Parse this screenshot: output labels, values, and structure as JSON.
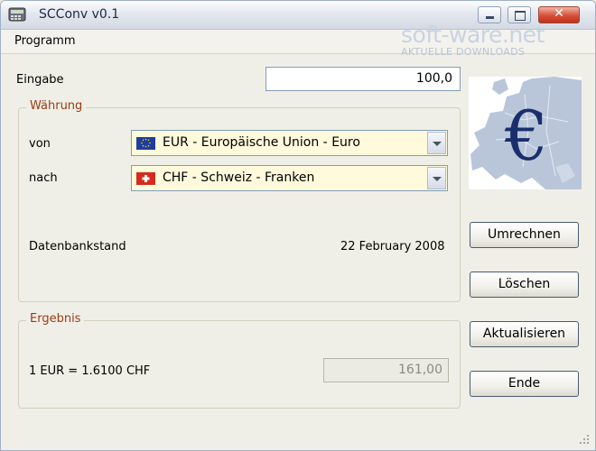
{
  "window": {
    "title": "SCConv v0.1"
  },
  "menu": {
    "items": [
      "Programm"
    ]
  },
  "watermark": {
    "brand": "soft-ware.net",
    "sub": "AKTUELLE DOWNLOADS"
  },
  "eingabe": {
    "label": "Eingabe",
    "value": "100,0"
  },
  "waehrung": {
    "title": "Währung",
    "von_label": "von",
    "von_value": "EUR - Europäische Union - Euro",
    "nach_label": "nach",
    "nach_value": "CHF - Schweiz - Franken",
    "db_label": "Datenbankstand",
    "db_date": "22 February 2008"
  },
  "ergebnis": {
    "title": "Ergebnis",
    "rate_text": "1 EUR = 1.6100 CHF",
    "value": "161,00"
  },
  "buttons": {
    "umrechnen": "Umrechnen",
    "loeschen": "Löschen",
    "aktualisieren": "Aktualisieren",
    "ende": "Ende"
  },
  "colors": {
    "group_title": "#9c3a14",
    "combo_bg": "#fffadc",
    "titlebar": "#e3e7ee",
    "close_button": "#d5503a"
  },
  "icons": {
    "app": "calculator-icon",
    "from_flag": "eu-flag-icon",
    "to_flag": "swiss-flag-icon",
    "logo": "euro-map-icon"
  }
}
